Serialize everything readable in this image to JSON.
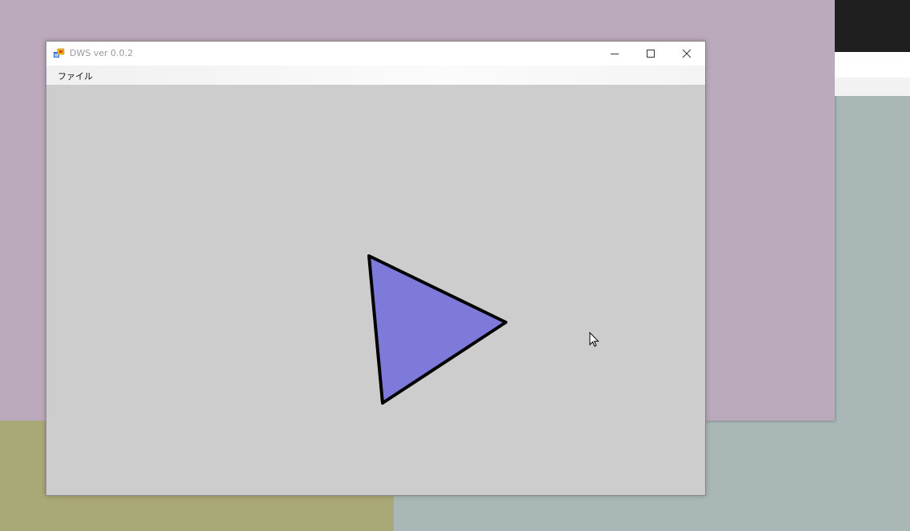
{
  "window": {
    "title": "DWS ver 0.0.2",
    "menu": [
      {
        "label": "ファイル"
      }
    ],
    "controls": {
      "minimize_icon": "minimize-icon",
      "maximize_icon": "maximize-icon",
      "close_icon": "close-icon"
    }
  },
  "canvas": {
    "background_color": "#cdcdcd",
    "shape": {
      "type": "triangle",
      "fill": "#7d7ad9",
      "stroke": "#000000"
    }
  },
  "desktop": {
    "colors": {
      "purple": "#bba9bc",
      "olive": "#a9a877",
      "teal": "#a9b8b7",
      "dark": "#1f1f1f"
    }
  }
}
